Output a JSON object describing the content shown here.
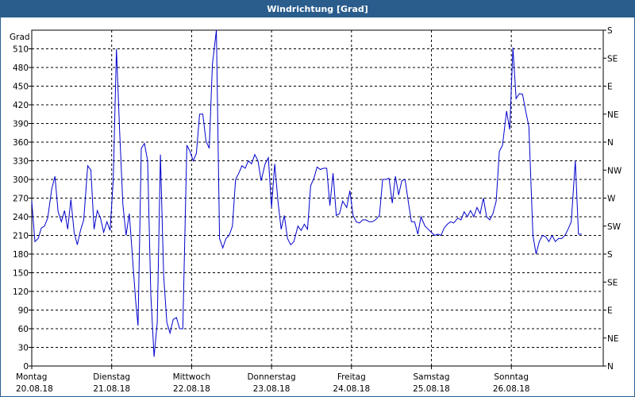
{
  "window": {
    "title": "Windrichtung [Grad]"
  },
  "chart_data": {
    "type": "line",
    "title": "Windrichtung [Grad]",
    "ylabel": "Grad",
    "ylim": [
      0,
      540
    ],
    "yticks": [
      0,
      30,
      60,
      90,
      120,
      150,
      180,
      210,
      240,
      270,
      300,
      330,
      360,
      390,
      420,
      450,
      480,
      510
    ],
    "right_axis": {
      "ticks": [
        0,
        45,
        90,
        135,
        180,
        225,
        270,
        315,
        360,
        405,
        450,
        495,
        540
      ],
      "labels": [
        "N",
        "NE",
        "E",
        "SE",
        "S",
        "SW",
        "W",
        "NW",
        "N",
        "NE",
        "E",
        "SE",
        "S"
      ]
    },
    "xlim": [
      0,
      7.15
    ],
    "x_unit": "days from Montag 20.08.18 00:00",
    "x_ticks": [
      {
        "x": 0,
        "day": "Montag",
        "date": "20.08.18"
      },
      {
        "x": 1,
        "day": "Dienstag",
        "date": "21.08.18"
      },
      {
        "x": 2,
        "day": "Mittwoch",
        "date": "22.08.18"
      },
      {
        "x": 3,
        "day": "Donnerstag",
        "date": "23.08.18"
      },
      {
        "x": 4,
        "day": "Freitag",
        "date": "24.08.18"
      },
      {
        "x": 5,
        "day": "Samstag",
        "date": "25.08.18"
      },
      {
        "x": 6,
        "day": "Sonntag",
        "date": "26.08.18"
      }
    ],
    "grid": true,
    "line_color": "#0000cc",
    "series": [
      {
        "name": "",
        "points": [
          [
            0.0,
            265
          ],
          [
            0.04,
            200
          ],
          [
            0.08,
            205
          ],
          [
            0.12,
            222
          ],
          [
            0.16,
            225
          ],
          [
            0.2,
            238
          ],
          [
            0.25,
            285
          ],
          [
            0.29,
            305
          ],
          [
            0.33,
            248
          ],
          [
            0.37,
            232
          ],
          [
            0.41,
            250
          ],
          [
            0.45,
            220
          ],
          [
            0.49,
            268
          ],
          [
            0.53,
            215
          ],
          [
            0.57,
            195
          ],
          [
            0.61,
            218
          ],
          [
            0.65,
            235
          ],
          [
            0.7,
            322
          ],
          [
            0.74,
            315
          ],
          [
            0.78,
            220
          ],
          [
            0.82,
            250
          ],
          [
            0.86,
            238
          ],
          [
            0.9,
            215
          ],
          [
            0.94,
            232
          ],
          [
            0.98,
            218
          ],
          [
            1.02,
            300
          ],
          [
            1.06,
            510
          ],
          [
            1.1,
            375
          ],
          [
            1.14,
            260
          ],
          [
            1.18,
            210
          ],
          [
            1.22,
            245
          ],
          [
            1.26,
            175
          ],
          [
            1.3,
            105
          ],
          [
            1.33,
            65
          ],
          [
            1.37,
            350
          ],
          [
            1.41,
            358
          ],
          [
            1.45,
            330
          ],
          [
            1.49,
            115
          ],
          [
            1.53,
            15
          ],
          [
            1.57,
            70
          ],
          [
            1.61,
            340
          ],
          [
            1.65,
            145
          ],
          [
            1.69,
            70
          ],
          [
            1.73,
            53
          ],
          [
            1.77,
            75
          ],
          [
            1.81,
            78
          ],
          [
            1.85,
            60
          ],
          [
            1.89,
            60
          ],
          [
            1.94,
            355
          ],
          [
            1.98,
            345
          ],
          [
            2.02,
            330
          ],
          [
            2.06,
            342
          ],
          [
            2.1,
            405
          ],
          [
            2.14,
            405
          ],
          [
            2.18,
            362
          ],
          [
            2.22,
            350
          ],
          [
            2.26,
            485
          ],
          [
            2.31,
            540
          ],
          [
            2.35,
            205
          ],
          [
            2.39,
            190
          ],
          [
            2.43,
            205
          ],
          [
            2.47,
            210
          ],
          [
            2.51,
            225
          ],
          [
            2.55,
            300
          ],
          [
            2.59,
            310
          ],
          [
            2.63,
            322
          ],
          [
            2.67,
            318
          ],
          [
            2.71,
            330
          ],
          [
            2.75,
            325
          ],
          [
            2.79,
            340
          ],
          [
            2.83,
            330
          ],
          [
            2.87,
            298
          ],
          [
            2.92,
            325
          ],
          [
            2.96,
            335
          ],
          [
            3.0,
            255
          ],
          [
            3.04,
            325
          ],
          [
            3.08,
            265
          ],
          [
            3.12,
            220
          ],
          [
            3.16,
            242
          ],
          [
            3.2,
            205
          ],
          [
            3.24,
            195
          ],
          [
            3.28,
            200
          ],
          [
            3.33,
            225
          ],
          [
            3.37,
            218
          ],
          [
            3.41,
            228
          ],
          [
            3.45,
            220
          ],
          [
            3.49,
            290
          ],
          [
            3.53,
            302
          ],
          [
            3.57,
            320
          ],
          [
            3.61,
            316
          ],
          [
            3.65,
            318
          ],
          [
            3.69,
            318
          ],
          [
            3.73,
            258
          ],
          [
            3.77,
            310
          ],
          [
            3.81,
            242
          ],
          [
            3.85,
            245
          ],
          [
            3.89,
            265
          ],
          [
            3.94,
            255
          ],
          [
            3.98,
            282
          ],
          [
            4.02,
            242
          ],
          [
            4.06,
            232
          ],
          [
            4.1,
            230
          ],
          [
            4.14,
            235
          ],
          [
            4.18,
            235
          ],
          [
            4.22,
            232
          ],
          [
            4.26,
            232
          ],
          [
            4.3,
            235
          ],
          [
            4.35,
            242
          ],
          [
            4.39,
            300
          ],
          [
            4.43,
            300
          ],
          [
            4.47,
            302
          ],
          [
            4.51,
            262
          ],
          [
            4.55,
            305
          ],
          [
            4.59,
            275
          ],
          [
            4.63,
            298
          ],
          [
            4.67,
            300
          ],
          [
            4.71,
            265
          ],
          [
            4.75,
            232
          ],
          [
            4.79,
            232
          ],
          [
            4.83,
            212
          ],
          [
            4.87,
            240
          ],
          [
            4.92,
            225
          ],
          [
            4.96,
            220
          ],
          [
            5.0,
            215
          ],
          [
            5.04,
            210
          ],
          [
            5.08,
            212
          ],
          [
            5.12,
            210
          ],
          [
            5.16,
            222
          ],
          [
            5.2,
            228
          ],
          [
            5.24,
            232
          ],
          [
            5.28,
            230
          ],
          [
            5.33,
            238
          ],
          [
            5.37,
            235
          ],
          [
            5.41,
            248
          ],
          [
            5.45,
            240
          ],
          [
            5.49,
            250
          ],
          [
            5.53,
            240
          ],
          [
            5.57,
            255
          ],
          [
            5.61,
            245
          ],
          [
            5.65,
            270
          ],
          [
            5.69,
            240
          ],
          [
            5.73,
            235
          ],
          [
            5.77,
            245
          ],
          [
            5.81,
            265
          ],
          [
            5.85,
            345
          ],
          [
            5.89,
            355
          ],
          [
            5.94,
            410
          ],
          [
            5.98,
            380
          ],
          [
            6.02,
            512
          ],
          [
            6.06,
            430
          ],
          [
            6.1,
            438
          ],
          [
            6.14,
            437
          ],
          [
            6.18,
            410
          ],
          [
            6.22,
            385
          ],
          [
            6.27,
            210
          ],
          [
            6.31,
            180
          ],
          [
            6.35,
            200
          ],
          [
            6.39,
            210
          ],
          [
            6.43,
            208
          ],
          [
            6.47,
            200
          ],
          [
            6.51,
            210
          ],
          [
            6.55,
            200
          ],
          [
            6.59,
            205
          ],
          [
            6.63,
            205
          ],
          [
            6.67,
            210
          ],
          [
            6.71,
            220
          ],
          [
            6.75,
            232
          ],
          [
            6.8,
            330
          ],
          [
            6.84,
            212
          ],
          [
            6.88,
            212
          ]
        ]
      }
    ]
  }
}
